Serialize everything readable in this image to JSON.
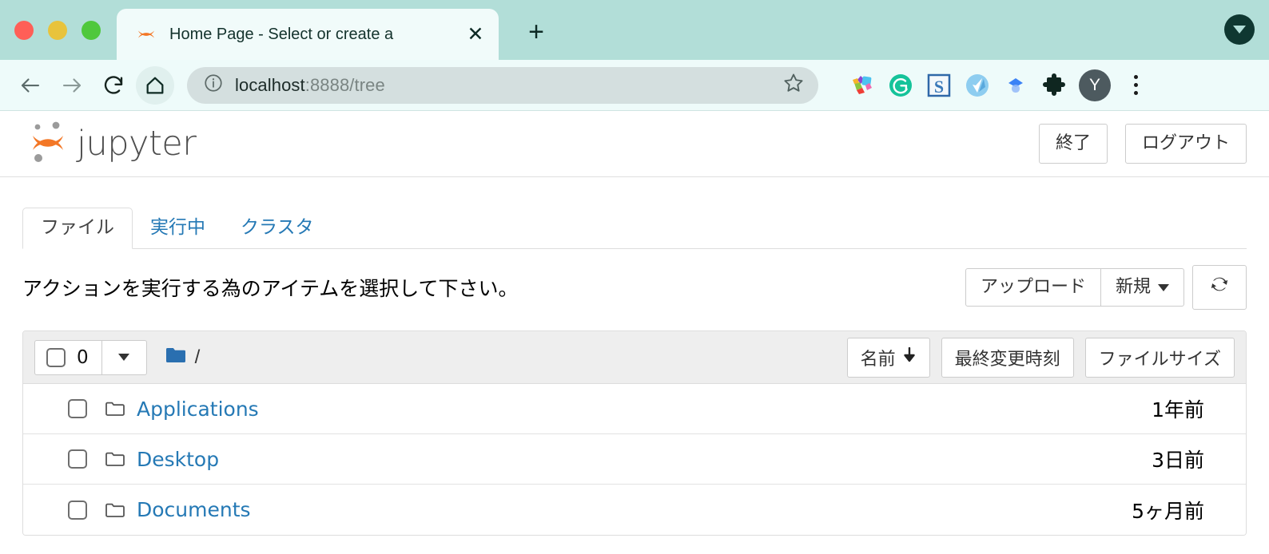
{
  "browser": {
    "tab": {
      "title": "Home Page - Select or create a",
      "favicon_icon": "jupyter-favicon-icon",
      "close_icon": "close-icon"
    },
    "new_tab_label": "+",
    "tab_search_icon": "tab-search-caret-icon",
    "toolbar": {
      "back_icon": "back-arrow-icon",
      "forward_icon": "forward-arrow-icon",
      "reload_icon": "reload-icon",
      "home_icon": "home-icon",
      "info_icon": "site-info-icon",
      "url_host": "localhost",
      "url_rest": ":8888/tree",
      "bookmark_icon": "star-icon",
      "extensions": [
        "pinwheel-extension-icon",
        "grammarly-extension-icon",
        "s-extension-icon",
        "v-extension-icon",
        "diamond-extension-icon",
        "puzzle-extensions-icon"
      ],
      "profile_initial": "Y",
      "menu_icon": "kebab-menu-icon"
    },
    "colors": {
      "tabstrip": "#b2ded8",
      "toolbar": "#eefbfa",
      "omnibox": "#d4dfdf",
      "active_tab": "#f1fbfa"
    }
  },
  "jupyter": {
    "logo_text": "jupyter",
    "logo_icon": "jupyter-logo-icon",
    "header_buttons": [
      {
        "label": "終了",
        "name": "quit-button"
      },
      {
        "label": "ログアウト",
        "name": "logout-button"
      }
    ],
    "tabs": [
      {
        "label": "ファイル",
        "active": true
      },
      {
        "label": "実行中",
        "active": false
      },
      {
        "label": "クラスタ",
        "active": false
      }
    ],
    "actions_message": "アクションを実行する為のアイテムを選択して下さい。",
    "toolbar_buttons": {
      "upload": "アップロード",
      "new": "新規",
      "new_caret_icon": "caret-down-icon",
      "refresh_icon": "refresh-icon"
    },
    "selector": {
      "checkbox_icon": "checkbox-icon",
      "count": "0",
      "caret_icon": "caret-down-icon"
    },
    "breadcrumb": {
      "folder_icon": "folder-filled-icon",
      "path": "/"
    },
    "columns": [
      {
        "label": "名前",
        "sort_icon": "arrow-down-icon",
        "name": "sort-by-name-button"
      },
      {
        "label": "最終変更時刻",
        "sort_icon": "",
        "name": "sort-by-modified-button"
      },
      {
        "label": "ファイルサイズ",
        "sort_icon": "",
        "name": "sort-by-size-button"
      }
    ],
    "files": [
      {
        "name": "Applications",
        "icon": "folder-outline-icon",
        "modified": "1年前",
        "size": ""
      },
      {
        "name": "Desktop",
        "icon": "folder-outline-icon",
        "modified": "3日前",
        "size": ""
      },
      {
        "name": "Documents",
        "icon": "folder-outline-icon",
        "modified": "5ヶ月前",
        "size": ""
      }
    ],
    "colors": {
      "link": "#2579b5",
      "accent": "#f37726",
      "panel_head": "#eeeeee"
    }
  }
}
